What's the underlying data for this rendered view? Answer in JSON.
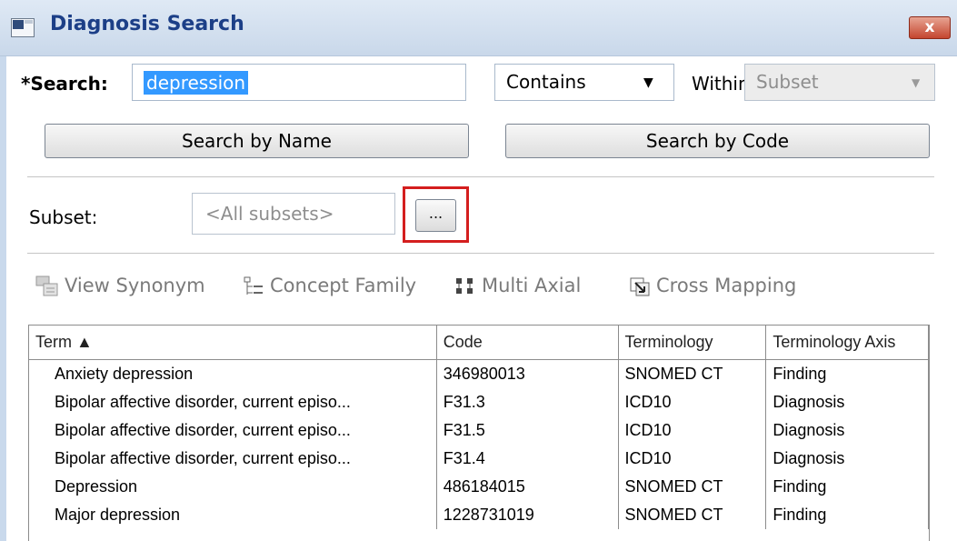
{
  "window": {
    "title": "Diagnosis Search",
    "close_label": "x"
  },
  "search": {
    "label": "*Search:",
    "value": "depression",
    "match_mode": "Contains",
    "within_label": "Within:",
    "within_value": "Subset",
    "search_by_name_label": "Search by Name",
    "search_by_code_label": "Search by Code"
  },
  "subset": {
    "label": "Subset:",
    "placeholder": "<All subsets>",
    "browse_label": "..."
  },
  "toolbar": {
    "view_synonym": "View Synonym",
    "concept_family": "Concept Family",
    "multi_axial": "Multi Axial",
    "cross_mapping": "Cross Mapping"
  },
  "table": {
    "columns": [
      "Term ▲",
      "Code",
      "Terminology",
      "Terminology Axis"
    ],
    "rows": [
      [
        "Anxiety depression",
        "346980013",
        "SNOMED CT",
        "Finding"
      ],
      [
        "Bipolar affective disorder, current episo...",
        "F31.3",
        "ICD10",
        "Diagnosis"
      ],
      [
        "Bipolar affective disorder, current episo...",
        "F31.5",
        "ICD10",
        "Diagnosis"
      ],
      [
        "Bipolar affective disorder, current episo...",
        "F31.4",
        "ICD10",
        "Diagnosis"
      ],
      [
        "Depression",
        "486184015",
        "SNOMED CT",
        "Finding"
      ],
      [
        "Major depression",
        "1228731019",
        "SNOMED CT",
        "Finding"
      ]
    ]
  },
  "colors": {
    "title_text": "#1c3f87",
    "highlight_border": "#d41e1e",
    "selection": "#3399ff"
  }
}
